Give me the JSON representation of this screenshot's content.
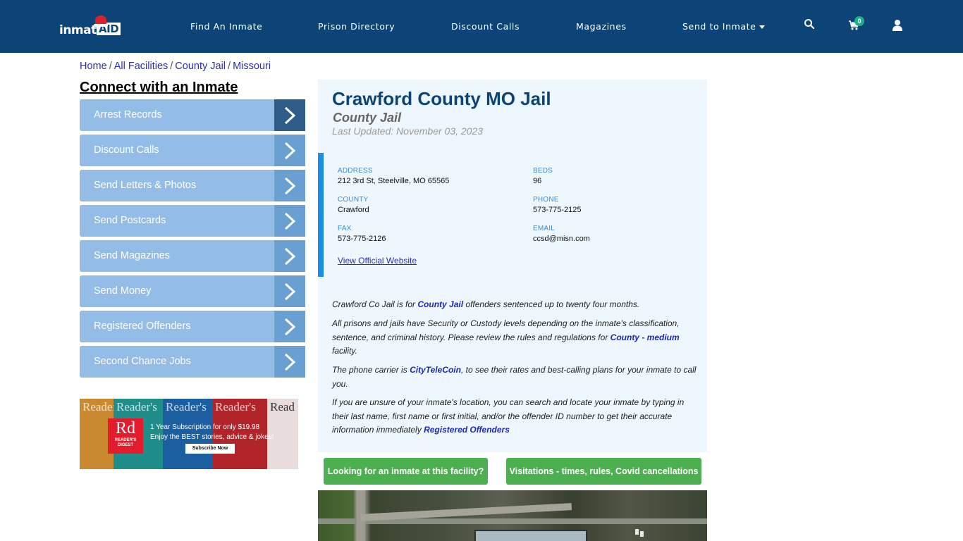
{
  "header": {
    "logo_text_1": "inmate",
    "logo_text_2": "AID",
    "nav": [
      {
        "label": "Find An Inmate"
      },
      {
        "label": "Prison Directory"
      },
      {
        "label": "Discount Calls"
      },
      {
        "label": "Magazines"
      },
      {
        "label": "Send to Inmate",
        "has_dropdown": true
      }
    ],
    "icons": [
      "search-icon",
      "cart-icon",
      "user-icon"
    ],
    "cart_count": "0",
    "colors": {
      "background": "#0d4477",
      "badge": "#1fae8a"
    }
  },
  "breadcrumb": [
    {
      "label": "Home"
    },
    {
      "label": "All Facilities"
    },
    {
      "label": "County Jail"
    },
    {
      "label": "Missouri"
    }
  ],
  "sidebar": {
    "title": "Connect with an Inmate",
    "items": [
      {
        "label": "Arrest Records",
        "active": true
      },
      {
        "label": "Discount Calls"
      },
      {
        "label": "Send Letters & Photos"
      },
      {
        "label": "Send Postcards"
      },
      {
        "label": "Send Magazines"
      },
      {
        "label": "Send Money"
      },
      {
        "label": "Registered Offenders"
      },
      {
        "label": "Second Chance Jobs"
      }
    ],
    "ad": {
      "covers": [
        "Reader's",
        "Reader's",
        "Reader's",
        "Reader's",
        "Read"
      ],
      "brand_big": "Rd",
      "brand_small_1": "READER'S",
      "brand_small_2": "DIGEST",
      "line1": "1 Year Subscription for only $19.98",
      "line2": "Enjoy the BEST stories, advice & jokes!",
      "button": "Subscribe Now"
    }
  },
  "facility": {
    "title": "Crawford County MO Jail",
    "type": "County Jail",
    "last_updated": "Last Updated: November 03, 2023",
    "details": {
      "address_label": "ADDRESS",
      "address": "212 3rd St, Steelville, MO 65565",
      "beds_label": "BEDS",
      "beds": "96",
      "county_label": "COUNTY",
      "county": "Crawford",
      "phone_label": "PHONE",
      "phone": "573-775-2125",
      "fax_label": "FAX",
      "fax": "573-775-2126",
      "email_label": "EMAIL",
      "email": "ccsd@misn.com",
      "website_link": "View Official Website"
    },
    "description": {
      "p1_a": "Crawford Co Jail is for ",
      "p1_link": "County Jail",
      "p1_b": " offenders sentenced up to twenty four months.",
      "p2_a": "All prisons and jails have Security or Custody levels depending on the inmate's classification, sentence, and criminal history. Please review the rules and regulations for ",
      "p2_link": "County - medium",
      "p2_b": " facility.",
      "p3_a": "The phone carrier is ",
      "p3_link": "CityTeleCoin",
      "p3_b": ", to see their rates and best-calling plans for your inmate to call you.",
      "p4_a": "If you are unsure of your inmate's location, you can search and locate your inmate by typing in their last name, first name or first initial, and/or the offender ID number to get their accurate information immediately ",
      "p4_link": "Registered Offenders"
    },
    "buttons": {
      "find_inmate": "Looking for an inmate at this facility?",
      "visitations": "Visitations - times, rules, Covid cancellations"
    },
    "colors": {
      "title": "#0d4477",
      "panel_bg": "#edf7fd",
      "accent_bar": "#1a8ee6",
      "button": "#4caf50"
    }
  }
}
